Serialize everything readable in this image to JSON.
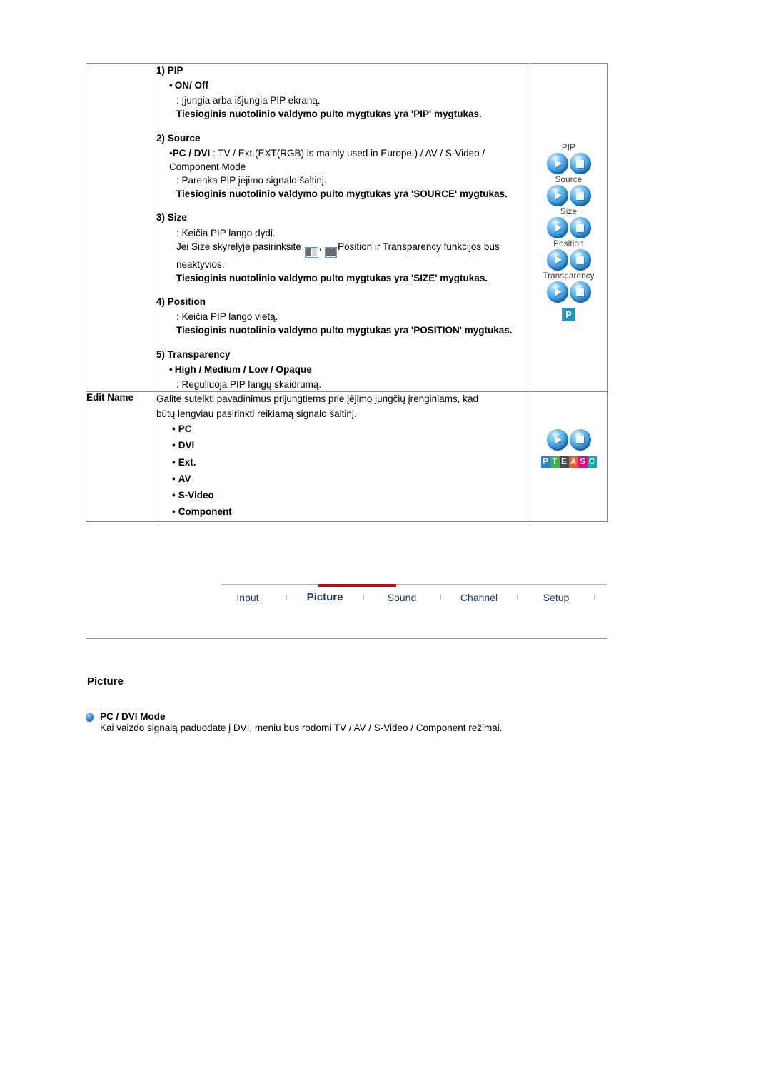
{
  "manual": {
    "pip_row": {
      "sections": [
        {
          "number": "1) PIP",
          "bullet": "ON/ Off",
          "desc": ": Įjungia arba išjungia PIP ekraną.",
          "desc_bold": "Tiesioginis nuotolinio valdymo pulto mygtukas yra 'PIP' mygtukas."
        },
        {
          "number": "2) Source",
          "bullet": "PC / DVI",
          "bullet_rest": " : TV / Ext.(EXT(RGB) is mainly used in Europe.) / AV / S-Video / Component Mode",
          "desc": ": Parenka PIP įėjimo signalo šaltinį.",
          "desc_bold": "Tiesioginis nuotolinio valdymo pulto mygtukas yra 'SOURCE' mygtukas."
        },
        {
          "number": "3) Size",
          "desc": ": Keičia PIP lango dydį.",
          "desc2_pre": "Jei Size skyrelyje pasirinksite ",
          "desc2_mid": ", ",
          "desc2_post": "Position ir Transparency funkcijos bus neaktyvios.",
          "desc_bold": "Tiesioginis nuotolinio valdymo pulto mygtukas yra 'SIZE' mygtukas."
        },
        {
          "number": "4) Position",
          "desc": ": Keičia PIP lango vietą.",
          "desc_bold": "Tiesioginis nuotolinio valdymo pulto mygtukas yra 'POSITION' mygtukas."
        },
        {
          "number": "5) Transparency",
          "bullet": "High / Medium / Low / Opaque",
          "desc": ": Reguliuoja PIP langų skaidrumą."
        }
      ],
      "icon_groups": [
        {
          "caption": "PIP"
        },
        {
          "caption": "Source"
        },
        {
          "caption": "Size"
        },
        {
          "caption": "Position"
        },
        {
          "caption": "Transparency"
        }
      ],
      "p_badge": "P"
    },
    "editname_row": {
      "label": "Edit Name",
      "intro_line1": "Galite suteikti pavadinimus prijungtiems prie įėjimo jungčių įrenginiams, kad",
      "intro_line2": "būtų lengviau pasirinkti reikiamą signalo šaltinį.",
      "items": [
        "PC",
        "DVI",
        "Ext.",
        "AV",
        "S-Video",
        "Component"
      ],
      "letter_blocks": [
        {
          "letter": "P",
          "color": "#2f7fd1"
        },
        {
          "letter": "T",
          "color": "#3cb54a"
        },
        {
          "letter": "E",
          "color": "#4a4a52"
        },
        {
          "letter": "A",
          "color": "#f05a28"
        },
        {
          "letter": "S",
          "color": "#ec008c"
        },
        {
          "letter": "C",
          "color": "#00aeb3"
        }
      ]
    },
    "bullet_char": "•"
  },
  "nav": {
    "items": [
      {
        "label": "Input",
        "active": false
      },
      {
        "label": "Picture",
        "active": true
      },
      {
        "label": "Sound",
        "active": false
      },
      {
        "label": "Channel",
        "active": false
      },
      {
        "label": "Setup",
        "active": false
      }
    ],
    "separator": "I",
    "accent_color": "#b5121b",
    "link_color": "#1d3a6b"
  },
  "lower": {
    "section_title": "Picture",
    "mode_title": "PC / DVI Mode",
    "mode_desc": "Kai vaizdo signalą paduodate į DVI, meniu bus rodomi TV / AV / S-Video / Component režimai."
  }
}
